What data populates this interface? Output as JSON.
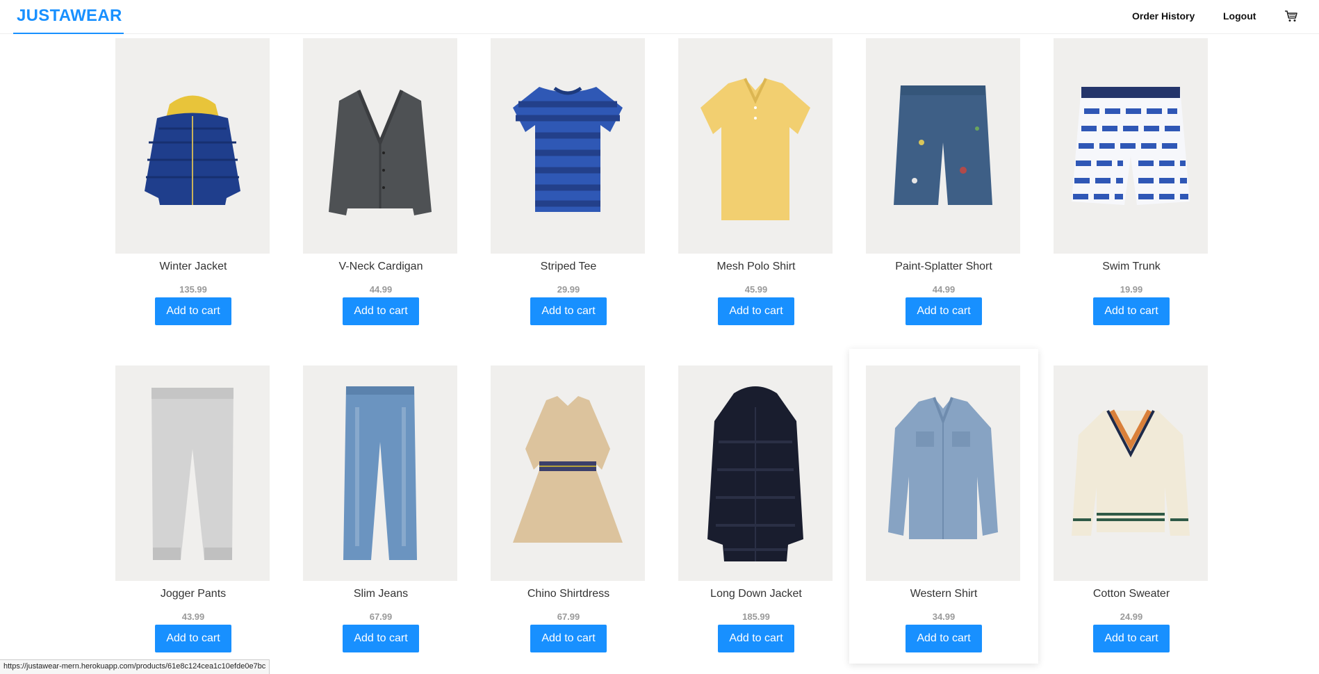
{
  "header": {
    "brand": "JUSTAWEAR",
    "order_history": "Order History",
    "logout": "Logout",
    "cart_icon": "shopping-cart-icon"
  },
  "colors": {
    "accent": "#1890ff",
    "image_bg": "#f0efed",
    "price": "#9a9a9a"
  },
  "products": [
    {
      "name": "Winter Jacket",
      "price": "135.99",
      "button": "Add to cart",
      "image": "navy-puffer-jacket-yellow-hood"
    },
    {
      "name": "V-Neck Cardigan",
      "price": "44.99",
      "button": "Add to cart",
      "image": "gray-knit-cardigan"
    },
    {
      "name": "Striped Tee",
      "price": "29.99",
      "button": "Add to cart",
      "image": "blue-striped-tshirt"
    },
    {
      "name": "Mesh Polo Shirt",
      "price": "45.99",
      "button": "Add to cart",
      "image": "yellow-polo-shirt"
    },
    {
      "name": "Paint-Splatter Short",
      "price": "44.99",
      "button": "Add to cart",
      "image": "denim-shorts-paint-splatter"
    },
    {
      "name": "Swim Trunk",
      "price": "19.99",
      "button": "Add to cart",
      "image": "blue-white-swim-trunks"
    },
    {
      "name": "Jogger Pants",
      "price": "43.99",
      "button": "Add to cart",
      "image": "gray-jogger-pants"
    },
    {
      "name": "Slim Jeans",
      "price": "67.99",
      "button": "Add to cart",
      "image": "light-blue-jeans"
    },
    {
      "name": "Chino Shirtdress",
      "price": "67.99",
      "button": "Add to cart",
      "image": "tan-shirtdress-striped-belt"
    },
    {
      "name": "Long Down Jacket",
      "price": "185.99",
      "button": "Add to cart",
      "image": "navy-long-down-coat"
    },
    {
      "name": "Western Shirt",
      "price": "34.99",
      "button": "Add to cart",
      "image": "chambray-western-shirt"
    },
    {
      "name": "Cotton Sweater",
      "price": "24.99",
      "button": "Add to cart",
      "image": "cream-cable-knit-cricket-sweater"
    }
  ],
  "status_bar": {
    "url": "https://justawear-mern.herokuapp.com/products/61e8c124cea1c10efde0e7bc"
  }
}
